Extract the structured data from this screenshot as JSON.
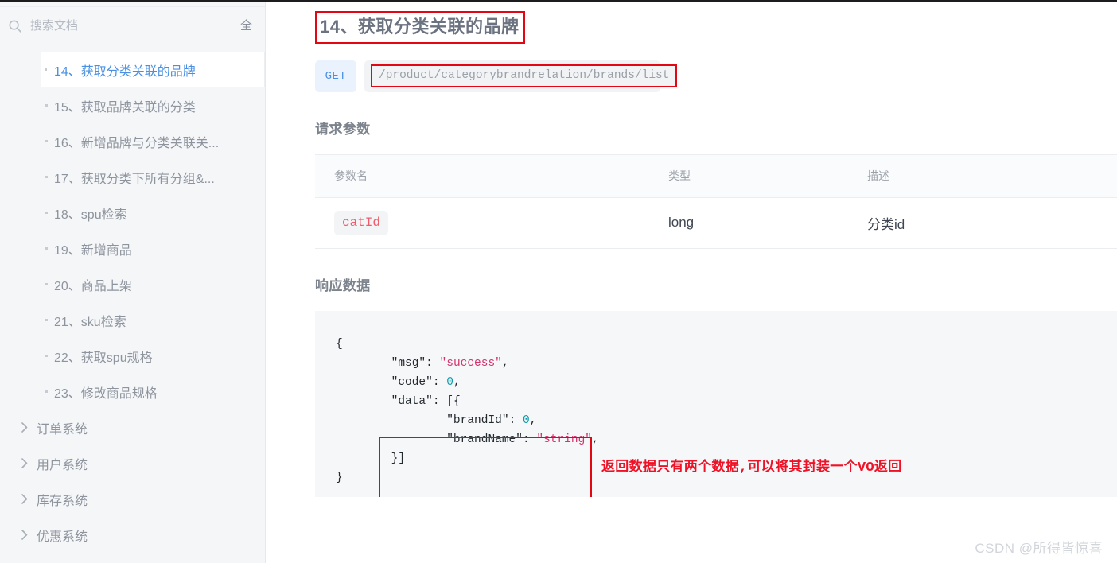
{
  "sidebar": {
    "search": {
      "icon": "search-icon",
      "placeholder": "搜索文档",
      "value": "",
      "filter_label": "全"
    },
    "doc_items": [
      {
        "label": "14、获取分类关联的品牌",
        "active": true
      },
      {
        "label": "15、获取品牌关联的分类",
        "active": false
      },
      {
        "label": "16、新增品牌与分类关联关...",
        "active": false
      },
      {
        "label": "17、获取分类下所有分组&...",
        "active": false
      },
      {
        "label": "18、spu检索",
        "active": false
      },
      {
        "label": "19、新增商品",
        "active": false
      },
      {
        "label": "20、商品上架",
        "active": false
      },
      {
        "label": "21、sku检索",
        "active": false
      },
      {
        "label": "22、获取spu规格",
        "active": false
      },
      {
        "label": "23、修改商品规格",
        "active": false
      }
    ],
    "groups": [
      {
        "label": "订单系统",
        "icon": "chevron-right-icon"
      },
      {
        "label": "用户系统",
        "icon": "chevron-right-icon"
      },
      {
        "label": "库存系统",
        "icon": "chevron-right-icon"
      },
      {
        "label": "优惠系统",
        "icon": "chevron-right-icon"
      }
    ]
  },
  "main": {
    "title": "14、获取分类关联的品牌",
    "method": "GET",
    "url": "/product/categorybrandrelation/brands/list",
    "request_section_title": "请求参数",
    "table": {
      "headers": [
        "参数名",
        "类型",
        "描述"
      ],
      "rows": [
        {
          "name": "catId",
          "type": "long",
          "desc": "分类id"
        }
      ]
    },
    "response_section_title": "响应数据",
    "response_code": {
      "line_open": "{",
      "line_msg_key": "\"msg\"",
      "line_msg_val": "\"success\"",
      "line_code_key": "\"code\"",
      "line_code_val": "0",
      "line_data_key": "\"data\"",
      "line_data_open": "[{",
      "line_brandid_key": "\"brandId\"",
      "line_brandid_val": "0",
      "line_brandname_key": "\"brandName\"",
      "line_brandname_val": "\"string\"",
      "line_data_close": "}]",
      "line_close": "}"
    },
    "annotation": "返回数据只有两个数据,可以将其封装一个VO返回"
  },
  "watermark": "CSDN @所得皆惊喜",
  "colors": {
    "accent_blue": "#4a90e2",
    "annotation_red": "#ef1226",
    "box_red": "#e30613",
    "badge_pink": "#ef5b6b",
    "sidebar_bg": "#f5f6f8",
    "code_bg": "#f6f7f9"
  }
}
